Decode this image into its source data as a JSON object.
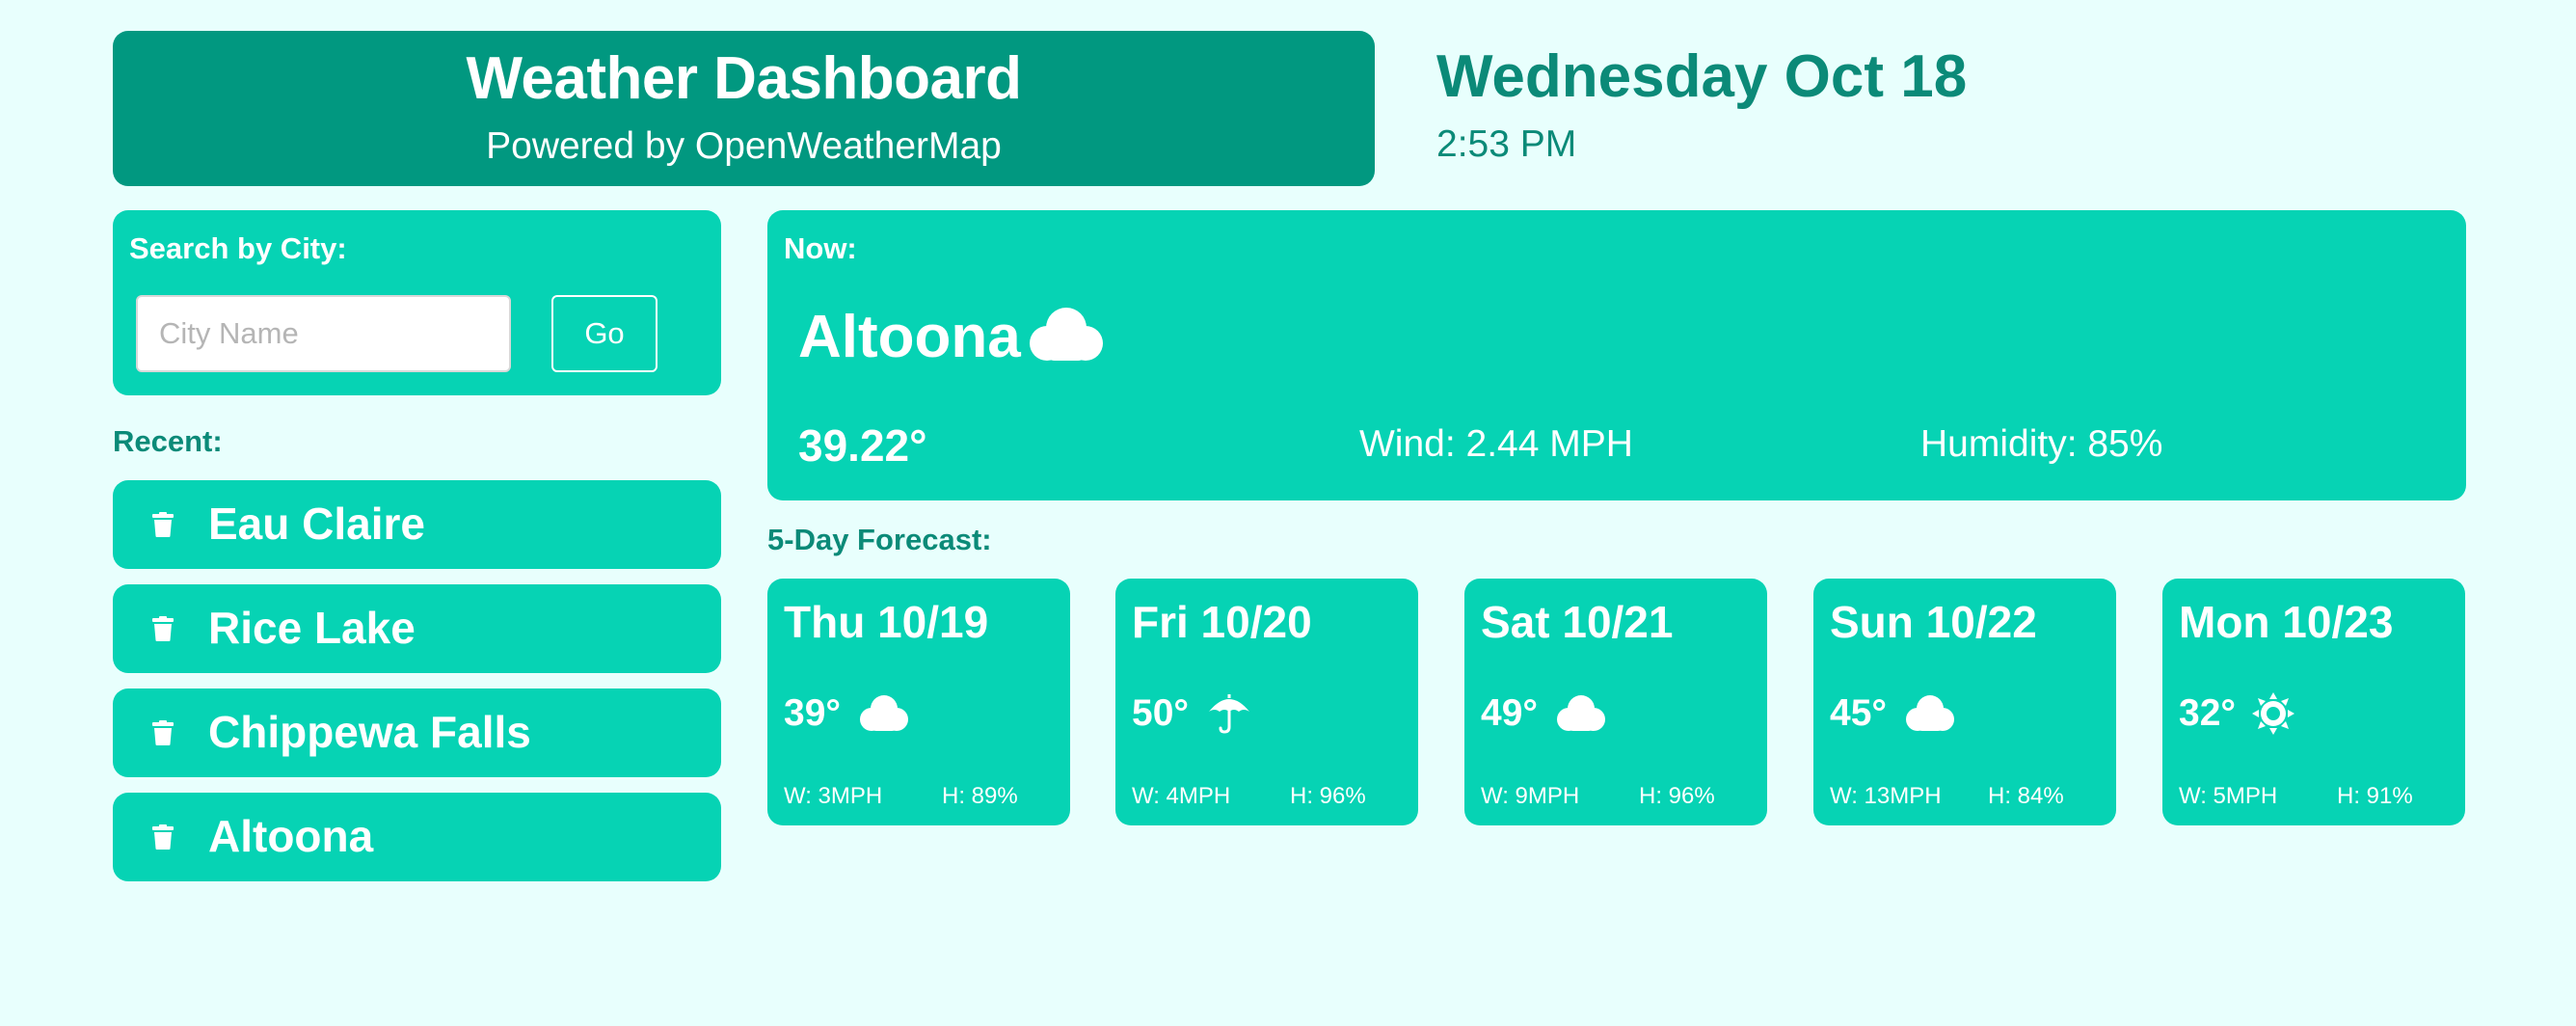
{
  "header": {
    "title": "Weather Dashboard",
    "subtitle": "Powered by OpenWeatherMap"
  },
  "clock": {
    "date": "Wednesday Oct 18",
    "time": "2:53 PM"
  },
  "search": {
    "label": "Search by City:",
    "placeholder": "City Name",
    "value": "",
    "button_label": "Go"
  },
  "recent": {
    "label": "Recent:",
    "items": [
      {
        "label": "Eau Claire",
        "icon": "trash-icon"
      },
      {
        "label": "Rice Lake",
        "icon": "trash-icon"
      },
      {
        "label": "Chippewa Falls",
        "icon": "trash-icon"
      },
      {
        "label": "Altoona",
        "icon": "trash-icon"
      }
    ]
  },
  "now": {
    "label": "Now:",
    "city": "Altoona",
    "icon": "cloud-icon",
    "temp": "39.22°",
    "wind": "Wind: 2.44 MPH",
    "humidity": "Humidity: 85%"
  },
  "forecast": {
    "label": "5-Day Forecast:",
    "days": [
      {
        "date": "Thu 10/19",
        "temp": "39°",
        "icon": "cloud-icon",
        "wind": "W: 3MPH",
        "humidity": "H: 89%"
      },
      {
        "date": "Fri 10/20",
        "temp": "50°",
        "icon": "umbrella-icon",
        "wind": "W: 4MPH",
        "humidity": "H: 96%"
      },
      {
        "date": "Sat 10/21",
        "temp": "49°",
        "icon": "cloud-icon",
        "wind": "W: 9MPH",
        "humidity": "H: 96%"
      },
      {
        "date": "Sun 10/22",
        "temp": "45°",
        "icon": "cloud-icon",
        "wind": "W: 13MPH",
        "humidity": "H: 84%"
      },
      {
        "date": "Mon 10/23",
        "temp": "32°",
        "icon": "sun-icon",
        "wind": "W: 5MPH",
        "humidity": "H: 91%"
      }
    ]
  },
  "colors": {
    "background": "#e8fffd",
    "header": "#019880",
    "card": "#06d3b4",
    "accent_text": "#0b8a78",
    "text_on_card": "#ffffff"
  }
}
